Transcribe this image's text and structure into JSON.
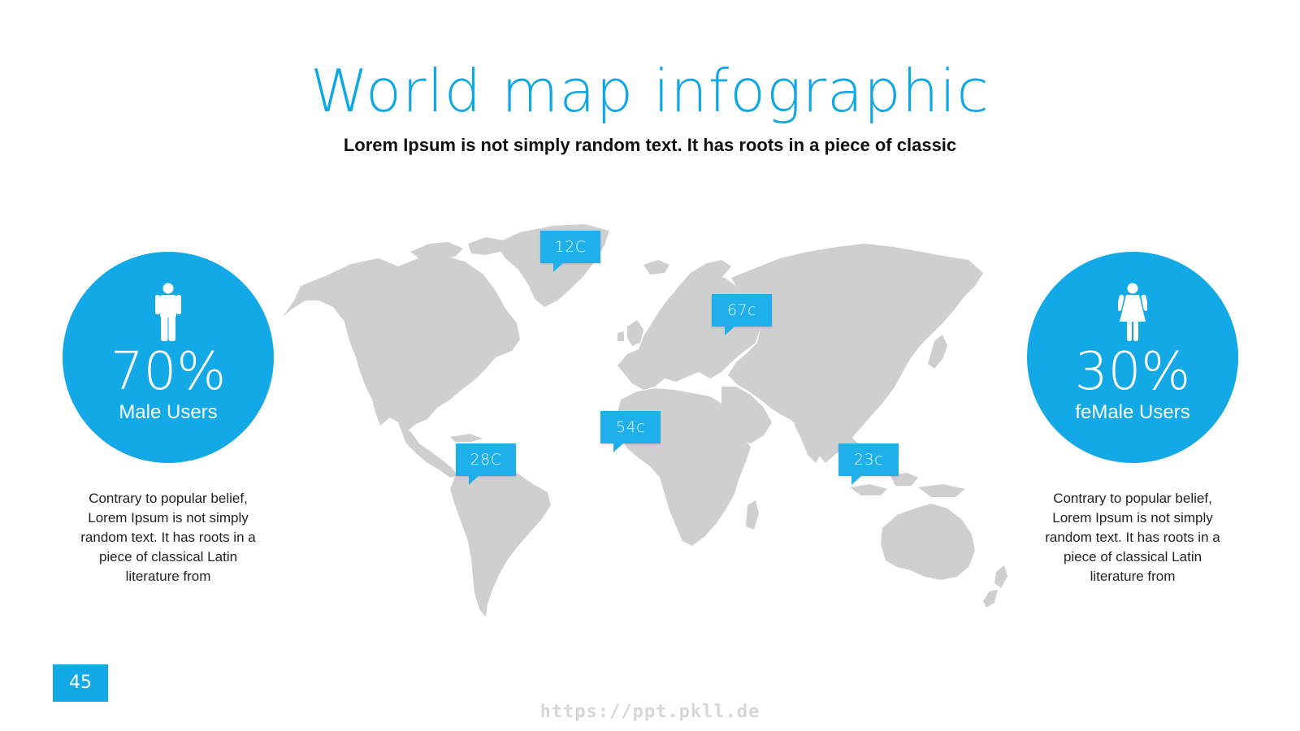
{
  "slide": {
    "title": "World map infographic",
    "subtitle": "Lorem Ipsum is not simply random text. It has roots in a piece of classic",
    "accent_color": "#12a9e6",
    "map_color": "#cfcfcf",
    "page_number": "45",
    "watermark": "https://ppt.pkll.de"
  },
  "stats": {
    "male": {
      "icon": "male-person-icon",
      "percent": "70%",
      "label": "Male Users",
      "description": "Contrary to popular belief, Lorem Ipsum is not simply random text. It has roots in a piece of classical Latin literature from"
    },
    "female": {
      "icon": "female-person-icon",
      "percent": "30%",
      "label": "feMale Users",
      "description": "Contrary to popular belief, Lorem Ipsum is not simply random text. It has roots in a piece of classical Latin literature from"
    }
  },
  "markers": [
    {
      "id": "greenland",
      "label": "12C"
    },
    {
      "id": "russia",
      "label": "67c"
    },
    {
      "id": "africa",
      "label": "54c"
    },
    {
      "id": "south-america",
      "label": "28C"
    },
    {
      "id": "southeast-asia",
      "label": "23c"
    }
  ]
}
